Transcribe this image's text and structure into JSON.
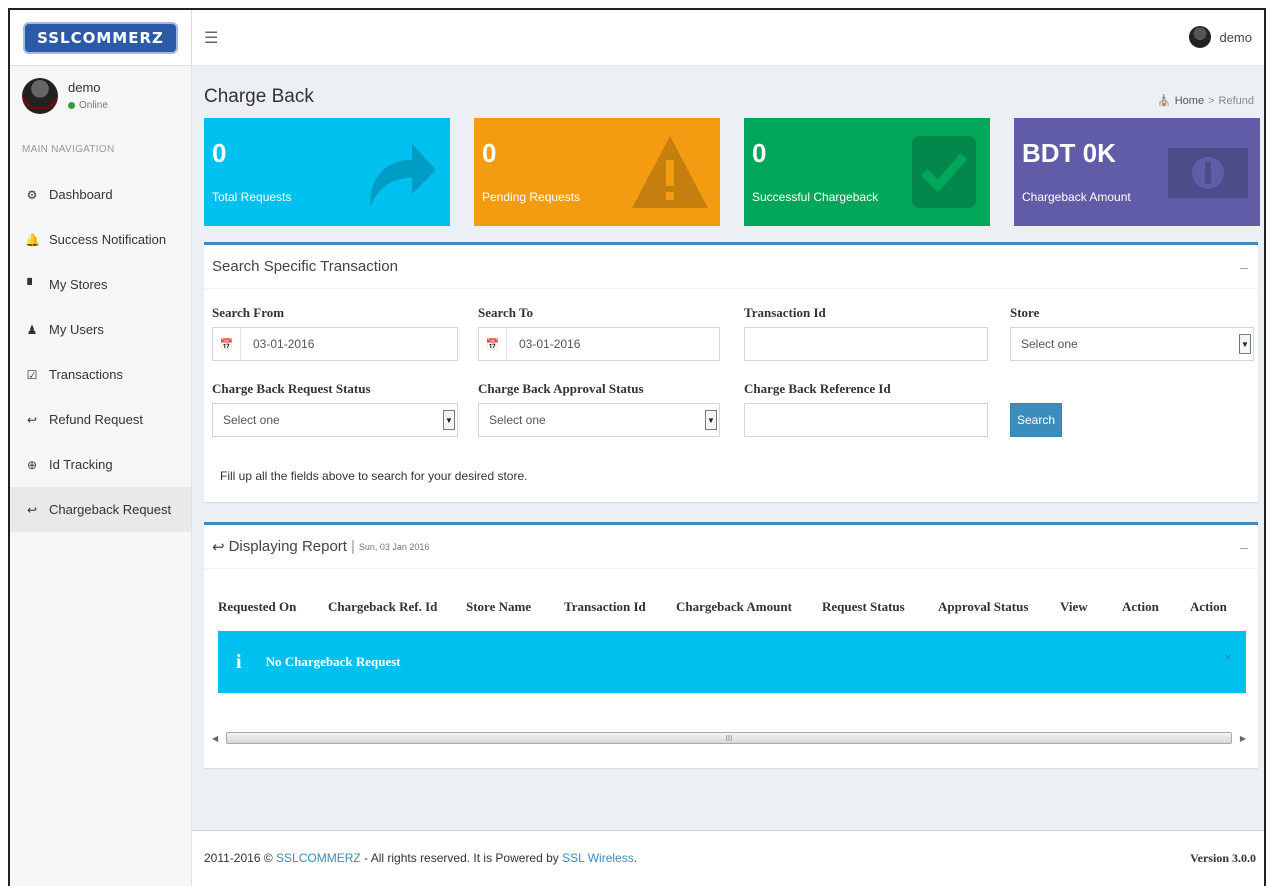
{
  "brand": {
    "logo_text": "SSLCOMMERZ",
    "primary_color": "#3c8dbc"
  },
  "topbar": {
    "menu_icon": "hamburger-icon",
    "user_name": "demo"
  },
  "sidebar": {
    "user": {
      "name": "demo",
      "status": "Online"
    },
    "nav_header": "MAIN NAVIGATION",
    "items": [
      {
        "label": "Dashboard",
        "icon": "dashboard-icon"
      },
      {
        "label": "Success Notification",
        "icon": "bell-icon"
      },
      {
        "label": "My Stores",
        "icon": "store-icon"
      },
      {
        "label": "My Users",
        "icon": "users-icon"
      },
      {
        "label": "Transactions",
        "icon": "check-square-icon"
      },
      {
        "label": "Refund Request",
        "icon": "reply-icon"
      },
      {
        "label": "Id Tracking",
        "icon": "crosshair-icon"
      },
      {
        "label": "Chargeback Request",
        "icon": "reply-icon",
        "active": true
      }
    ]
  },
  "page": {
    "title": "Charge Back",
    "breadcrumb": {
      "home": "Home",
      "current": "Refund"
    }
  },
  "stats": [
    {
      "value": "0",
      "label": "Total Requests",
      "color": "#00c0ef",
      "icon": "share-arrow-icon"
    },
    {
      "value": "0",
      "label": "Pending Requests",
      "color": "#f39c12",
      "icon": "warning-icon"
    },
    {
      "value": "0",
      "label": "Successful Chargeback",
      "color": "#00a65a",
      "icon": "check-icon"
    },
    {
      "value": "BDT 0K",
      "label": "Chargeback Amount",
      "color": "#605ca8",
      "icon": "money-icon"
    }
  ],
  "search": {
    "title": "Search Specific Transaction",
    "collapse": "–",
    "fields": {
      "search_from": {
        "label": "Search From",
        "value": "03-01-2016"
      },
      "search_to": {
        "label": "Search To",
        "value": "03-01-2016"
      },
      "transaction_id": {
        "label": "Transaction Id",
        "value": ""
      },
      "store": {
        "label": "Store",
        "value": "Select one"
      },
      "request_status": {
        "label": "Charge Back Request Status",
        "value": "Select one"
      },
      "approval_status": {
        "label": "Charge Back Approval Status",
        "value": "Select one"
      },
      "reference_id": {
        "label": "Charge Back Reference Id",
        "value": ""
      }
    },
    "button": "Search",
    "hint": "Fill up all the fields above to search for your desired store."
  },
  "report": {
    "title": "Displaying Report",
    "date": "Sun, 03 Jan 2016",
    "collapse": "–",
    "columns": [
      "Requested On",
      "Chargeback Ref. Id",
      "Store Name",
      "Transaction Id",
      "Chargeback Amount",
      "Request Status",
      "Approval Status",
      "View",
      "Action",
      "Action"
    ],
    "alert": {
      "icon": "info-icon",
      "text": "No Chargeback Request",
      "close": "×"
    },
    "scroll_thumb": "III"
  },
  "footer": {
    "prefix": "2011-2016 ©",
    "company": "SSLCOMMERZ",
    "middle": "- All rights reserved. It is Powered by",
    "powered_by": "SSL Wireless",
    "end": ".",
    "version": "Version 3.0.0"
  }
}
